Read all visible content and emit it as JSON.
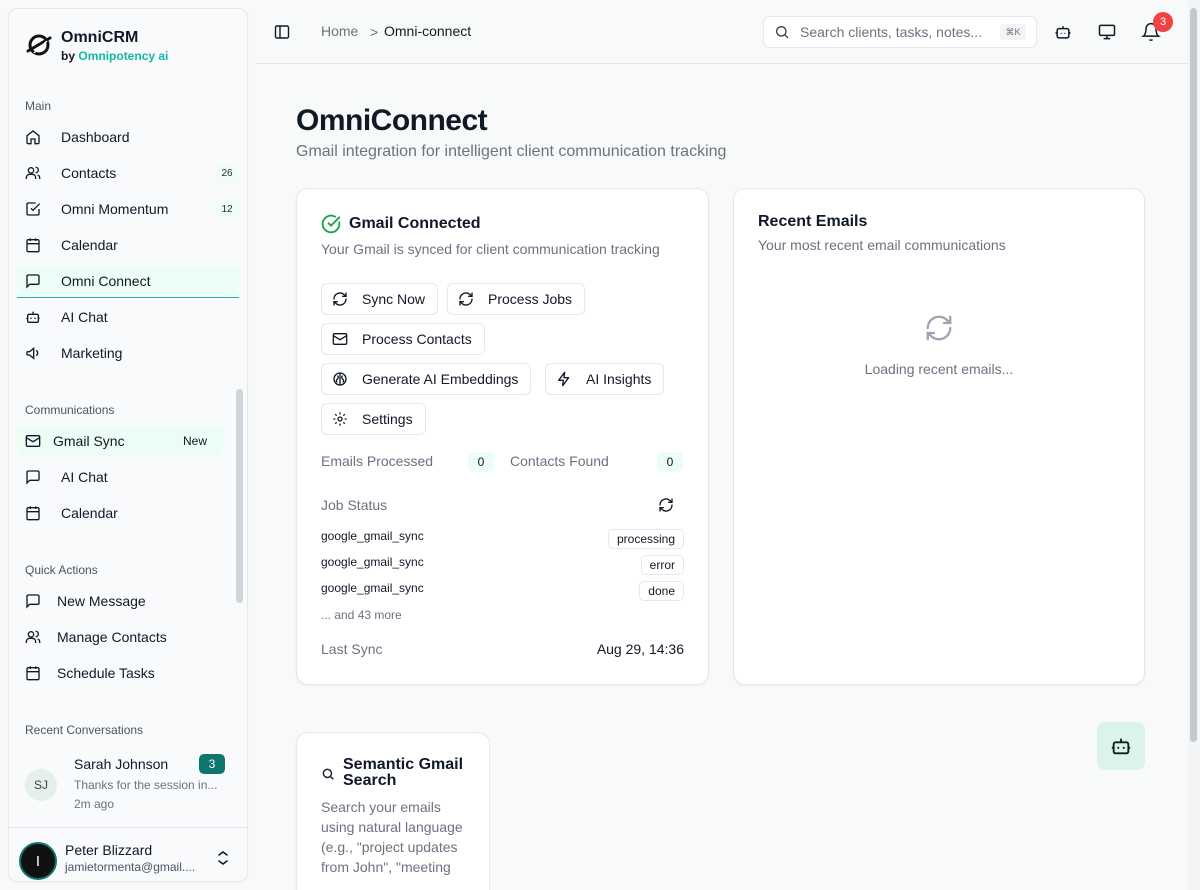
{
  "brand": {
    "title": "OmniCRM",
    "by": "by",
    "company": "Omnipotency ai"
  },
  "sidebar": {
    "main_label": "Main",
    "main": [
      {
        "label": "Dashboard",
        "icon": "home-icon"
      },
      {
        "label": "Contacts",
        "icon": "users-icon",
        "count": "26"
      },
      {
        "label": "Omni Momentum",
        "icon": "check-square-icon",
        "count": "12"
      },
      {
        "label": "Calendar",
        "icon": "calendar-icon"
      },
      {
        "label": "Omni Connect",
        "icon": "message-square-icon",
        "active": true
      },
      {
        "label": "AI Chat",
        "icon": "bot-icon"
      },
      {
        "label": "Marketing",
        "icon": "megaphone-icon"
      }
    ],
    "comms_label": "Communications",
    "comms": [
      {
        "label": "Gmail Sync",
        "icon": "mail-icon",
        "badge": "New",
        "active": true
      },
      {
        "label": "AI Chat",
        "icon": "message-square-icon"
      },
      {
        "label": "Calendar",
        "icon": "calendar-icon"
      }
    ],
    "quick_label": "Quick Actions",
    "quick": [
      {
        "label": "New Message",
        "icon": "message-square-icon"
      },
      {
        "label": "Manage Contacts",
        "icon": "users-icon"
      },
      {
        "label": "Schedule Tasks",
        "icon": "calendar-icon"
      }
    ],
    "recent_label": "Recent Conversations",
    "conversation": {
      "initials": "SJ",
      "name": "Sarah Johnson",
      "preview": "Thanks for the session in...",
      "time": "2m ago",
      "unread": "3"
    },
    "user": {
      "initial": "I",
      "name": "Peter Blizzard",
      "email": "jamietormenta@gmail...."
    }
  },
  "topbar": {
    "breadcrumb_home": "Home",
    "breadcrumb_sep": ">",
    "breadcrumb_current": "Omni-connect",
    "search_placeholder": "Search clients, tasks, notes...",
    "search_shortcut": "⌘K",
    "notification_count": "3"
  },
  "page": {
    "title": "OmniConnect",
    "subtitle": "Gmail integration for intelligent client communication tracking"
  },
  "gmail_card": {
    "title": "Gmail Connected",
    "description": "Your Gmail is synced for client communication tracking",
    "buttons": {
      "sync_now": "Sync Now",
      "process_jobs": "Process Jobs",
      "process_contacts": "Process Contacts",
      "embeddings": "Generate AI Embeddings",
      "insights": "AI Insights",
      "settings": "Settings"
    },
    "emails_processed_label": "Emails Processed",
    "emails_processed": "0",
    "contacts_found_label": "Contacts Found",
    "contacts_found": "0",
    "job_status_label": "Job Status",
    "jobs": [
      {
        "name": "google_gmail_sync",
        "status": "processing"
      },
      {
        "name": "google_gmail_sync",
        "status": "error"
      },
      {
        "name": "google_gmail_sync",
        "status": "done"
      }
    ],
    "more": "... and 43 more",
    "last_sync_label": "Last Sync",
    "last_sync": "Aug 29, 14:36"
  },
  "emails_card": {
    "title": "Recent Emails",
    "description": "Your most recent email communications",
    "loading": "Loading recent emails..."
  },
  "semantic_card": {
    "title": "Semantic Gmail Search",
    "description": "Search your emails using natural language (e.g., \"project updates from John\", \"meeting"
  },
  "colors": {
    "accent": "#14b8a6",
    "success": "#16a34a",
    "badge_bg": "#0f766e",
    "notification": "#ef4444"
  }
}
